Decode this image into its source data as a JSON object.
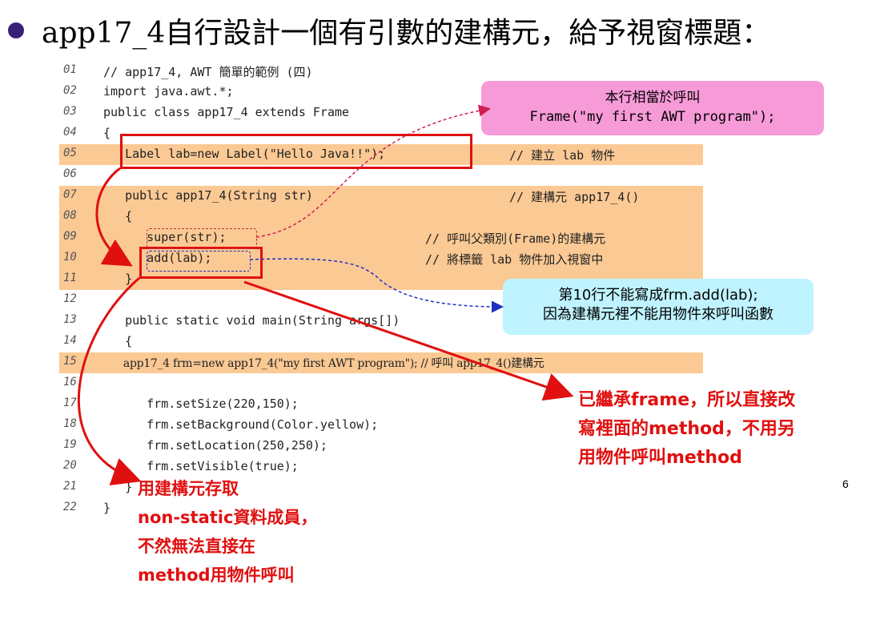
{
  "title": "app17_4自行設計一個有引數的建構元，給予視窗標題：",
  "page_number": "6",
  "code_lines": [
    {
      "num": "01",
      "code": "// app17_4, AWT 簡單的範例 (四)",
      "comment": "",
      "highlight": false
    },
    {
      "num": "02",
      "code": "import java.awt.*;",
      "comment": "",
      "highlight": false
    },
    {
      "num": "03",
      "code": "public class app17_4 extends Frame",
      "comment": "",
      "highlight": false
    },
    {
      "num": "04",
      "code": "{",
      "comment": "",
      "highlight": false
    },
    {
      "num": "05",
      "code": "   Label lab=new Label(\"Hello Java!!\");",
      "comment": "// 建立 lab 物件",
      "highlight": true
    },
    {
      "num": "06",
      "code": "",
      "comment": "",
      "highlight": false
    },
    {
      "num": "07",
      "code": "   public app17_4(String str)",
      "comment": "// 建構元 app17_4()",
      "highlight": true
    },
    {
      "num": "08",
      "code": "   {",
      "comment": "",
      "highlight": true
    },
    {
      "num": "09",
      "code": "      super(str);",
      "comment": "// 呼叫父類別(Frame)的建構元",
      "highlight": true
    },
    {
      "num": "10",
      "code": "      add(lab);",
      "comment": "// 將標籤 lab 物件加入視窗中",
      "highlight": true
    },
    {
      "num": "11",
      "code": "   }",
      "comment": "",
      "highlight": true
    },
    {
      "num": "12",
      "code": "",
      "comment": "",
      "highlight": false
    },
    {
      "num": "13",
      "code": "   public static void main(String args[])",
      "comment": "",
      "highlight": false
    },
    {
      "num": "14",
      "code": "   {",
      "comment": "",
      "highlight": false
    },
    {
      "num": "15",
      "code": "      app17_4 frm=new app17_4(\"my first AWT program\"); // 呼叫 app17_4()建構元",
      "comment": "",
      "highlight": true
    },
    {
      "num": "16",
      "code": "",
      "comment": "",
      "highlight": false
    },
    {
      "num": "17",
      "code": "      frm.setSize(220,150);",
      "comment": "",
      "highlight": false
    },
    {
      "num": "18",
      "code": "      frm.setBackground(Color.yellow);",
      "comment": "",
      "highlight": false
    },
    {
      "num": "19",
      "code": "      frm.setLocation(250,250);",
      "comment": "",
      "highlight": false
    },
    {
      "num": "20",
      "code": "      frm.setVisible(true);",
      "comment": "",
      "highlight": false
    },
    {
      "num": "21",
      "code": "   }",
      "comment": "",
      "highlight": false
    },
    {
      "num": "22",
      "code": "}",
      "comment": "",
      "highlight": false
    }
  ],
  "callout_pink": {
    "line1": "本行相當於呼叫",
    "line2": "Frame(\"my first AWT program\");"
  },
  "callout_cyan": {
    "line1": "第10行不能寫成frm.add(lab);",
    "line2": "因為建構元裡不能用物件來呼叫函數"
  },
  "note_right": [
    "已繼承frame，所以直接改",
    "寫裡面的method，不用另",
    "用物件呼叫method"
  ],
  "note_bottom": [
    "用建構元存取",
    "non-static資料成員，",
    "不然無法直接在",
    "method用物件呼叫"
  ],
  "colors": {
    "highlight": "#fbc994",
    "red": "#e01010",
    "pink": "#f79ad8",
    "cyan": "#bff3ff",
    "bullet": "#3a1f7a"
  }
}
